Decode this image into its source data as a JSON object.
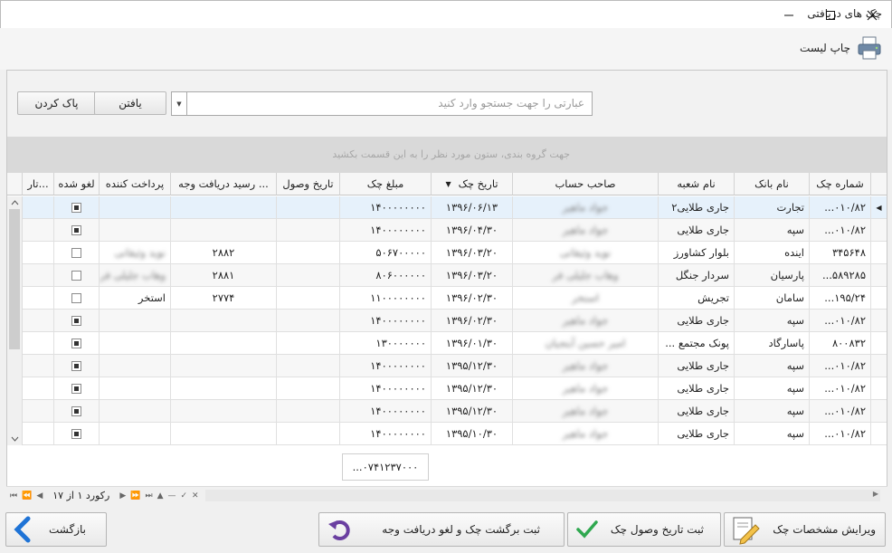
{
  "window": {
    "title": "چک های دریافتی"
  },
  "toolbar": {
    "print_label": "چاپ لیست"
  },
  "search": {
    "placeholder": "عبارتی را جهت جستجو وارد کنید",
    "find_label": "یافتن",
    "clear_label": "پاک کردن"
  },
  "group_hint": "جهت گروه بندی، ستون مورد نظر را به این قسمت بکشید",
  "columns": {
    "check_no": "شماره چک",
    "bank": "نام بانک",
    "branch": "نام شعبه",
    "holder": "صاحب حساب",
    "date": "تاریخ چک",
    "amount": "مبلغ چک",
    "received_date": "تاریخ وصول",
    "receipt": "رسید دریافت وجه ...",
    "payer": "پرداخت کننده",
    "cancelled": "لغو شده",
    "tar": "تار..."
  },
  "rows": [
    {
      "check_no": "...۰۱۰/۸۲",
      "bank": "تجارت",
      "branch": "جاری طلایی۲",
      "holder": "جواد ماهیر",
      "date": "۱۳۹۶/۰۶/۱۳",
      "amount": "۱۴۰۰۰۰۰۰۰۰",
      "receipt": "",
      "payer_blur": "",
      "payer": "",
      "cancelled": true,
      "selected": true
    },
    {
      "check_no": "...۰۱۰/۸۲",
      "bank": "سپه",
      "branch": "جاری طلایی",
      "holder": "جواد ماهیر",
      "date": "۱۳۹۶/۰۴/۳۰",
      "amount": "۱۴۰۰۰۰۰۰۰۰",
      "receipt": "",
      "payer_blur": "",
      "payer": "",
      "cancelled": true
    },
    {
      "check_no": "۳۴۵۶۴۸",
      "bank": "اینده",
      "branch": "بلوار کشاورز",
      "holder": "نوید وثیقانی",
      "date": "۱۳۹۶/۰۳/۲۰",
      "amount": "۵۰۶۷۰۰۰۰۰",
      "receipt": "۲۸۸۲",
      "payer_blur": "نوید وثیقانی",
      "payer": "",
      "cancelled": false
    },
    {
      "check_no": "...۵۸۹۲۸۵",
      "bank": "پارسیان",
      "branch": "سردار جنگل",
      "holder": "وهاب جلیلی فر",
      "date": "۱۳۹۶/۰۳/۲۰",
      "amount": "۸۰۶۰۰۰۰۰۰",
      "receipt": "۲۸۸۱",
      "payer_blur": "وهاب جلیلی فر",
      "payer": "",
      "cancelled": false
    },
    {
      "check_no": "...۱۹۵/۲۴",
      "bank": "سامان",
      "branch": "تجریش",
      "holder": "استخر",
      "date": "۱۳۹۶/۰۲/۳۰",
      "amount": "۱۱۰۰۰۰۰۰۰۰",
      "receipt": "۲۷۷۴",
      "payer_blur": "",
      "payer": "استخر",
      "cancelled": false
    },
    {
      "check_no": "...۰۱۰/۸۲",
      "bank": "سپه",
      "branch": "جاری طلایی",
      "holder": "جواد ماهیر",
      "date": "۱۳۹۶/۰۲/۳۰",
      "amount": "۱۴۰۰۰۰۰۰۰۰",
      "receipt": "",
      "payer_blur": "",
      "payer": "",
      "cancelled": true
    },
    {
      "check_no": "۸۰۰۸۳۲",
      "bank": "پاسارگاد",
      "branch": "پونک مجتمع ...",
      "holder": "امیر حسین آبتجیان",
      "date": "۱۳۹۶/۰۱/۳۰",
      "amount": "۱۳۰۰۰۰۰۰۰",
      "receipt": "",
      "payer_blur": "",
      "payer": "",
      "cancelled": true
    },
    {
      "check_no": "...۰۱۰/۸۲",
      "bank": "سپه",
      "branch": "جاری طلایی",
      "holder": "جواد ماهیر",
      "date": "۱۳۹۵/۱۲/۳۰",
      "amount": "۱۴۰۰۰۰۰۰۰۰",
      "receipt": "",
      "payer_blur": "",
      "payer": "",
      "cancelled": true
    },
    {
      "check_no": "...۰۱۰/۸۲",
      "bank": "سپه",
      "branch": "جاری طلایی",
      "holder": "جواد ماهیر",
      "date": "۱۳۹۵/۱۲/۳۰",
      "amount": "۱۴۰۰۰۰۰۰۰۰",
      "receipt": "",
      "payer_blur": "",
      "payer": "",
      "cancelled": true
    },
    {
      "check_no": "...۰۱۰/۸۲",
      "bank": "سپه",
      "branch": "جاری طلایی",
      "holder": "جواد ماهیر",
      "date": "۱۳۹۵/۱۲/۳۰",
      "amount": "۱۴۰۰۰۰۰۰۰۰",
      "receipt": "",
      "payer_blur": "",
      "payer": "",
      "cancelled": true
    },
    {
      "check_no": "...۰۱۰/۸۲",
      "bank": "سپه",
      "branch": "جاری طلایی",
      "holder": "جواد ماهیر",
      "date": "۱۳۹۵/۱۰/۳۰",
      "amount": "۱۴۰۰۰۰۰۰۰۰",
      "receipt": "",
      "payer_blur": "",
      "payer": "",
      "cancelled": true
    }
  ],
  "total_amount": "...۰۷۴۱۲۳۷۰۰۰",
  "record_nav": "رکورد ۱ از ۱۷",
  "buttons": {
    "edit": "ویرایش مشخصات چک",
    "register_receive": "ثبت تاریخ وصول چک",
    "return_cancel": "ثبت برگشت چک و لغو دریافت وجه",
    "back": "بازگشت"
  },
  "colors": {
    "selected_row": "#e6f1fb",
    "alt_row": "#f7f7f7",
    "accent_blue": "#1e73d6",
    "check_green": "#2fa84f",
    "purple": "#6a3fa0"
  }
}
